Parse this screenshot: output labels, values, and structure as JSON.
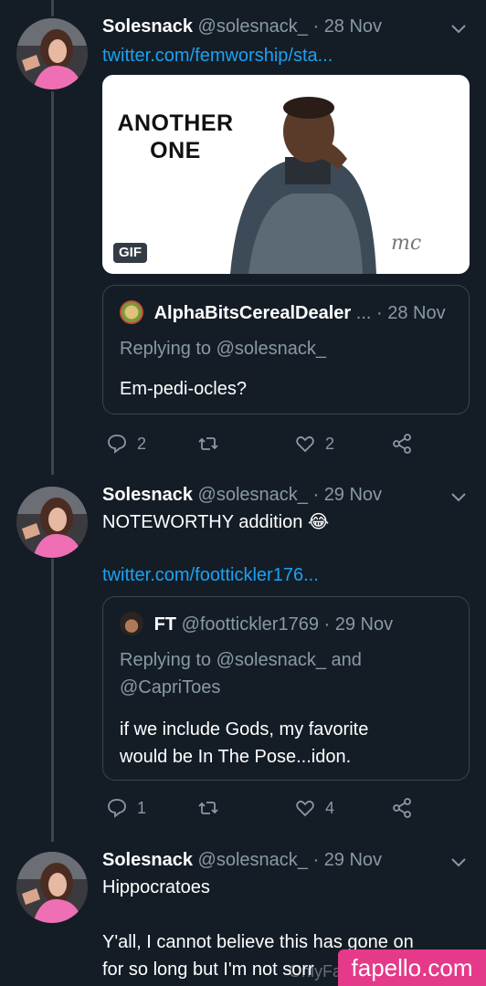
{
  "tweets": [
    {
      "name": "Solesnack",
      "handle": "@solesnack_",
      "dot": "·",
      "date": "28 Nov",
      "link": "twitter.com/femworship/sta...",
      "gif": {
        "text_line1": "ANOTHER",
        "text_line2": "ONE",
        "badge": "GIF",
        "signature": "mc"
      },
      "quote": {
        "name": "AlphaBitsCerealDealer",
        "ellipsis": "...",
        "dot": "·",
        "date": "28 Nov",
        "replying": "Replying to @solesnack_",
        "text": "Em-pedi-ocles?"
      },
      "actions": {
        "replies": "2",
        "retweets": "",
        "likes": "2"
      }
    },
    {
      "name": "Solesnack",
      "handle": "@solesnack_",
      "dot": "·",
      "date": "29 Nov",
      "text": "NOTEWORTHY addition 😂",
      "link": "twitter.com/foottickler176...",
      "quote": {
        "name": "FT",
        "handle": "@foottickler1769",
        "dot": "·",
        "date": "29 Nov",
        "replying_line1": "Replying to @solesnack_ and",
        "replying_line2": "@CapriToes",
        "text_line1": "if we include Gods, my favorite",
        "text_line2": "would be In The Pose...idon."
      },
      "actions": {
        "replies": "1",
        "retweets": "",
        "likes": "4"
      }
    },
    {
      "name": "Solesnack",
      "handle": "@solesnack_",
      "dot": "·",
      "date": "29 Nov",
      "text_line1": "Hippocratoes",
      "text_line2": "Y'all, I cannot believe this has gone on",
      "text_line3": "for so long but I'm not sorr"
    }
  ],
  "watermark": "fapello.com",
  "watermark_faint": "OnlyFa",
  "colors": {
    "background": "#141d26",
    "link": "#1da1f2",
    "muted": "#8899a6",
    "watermark": "#e5398a"
  }
}
